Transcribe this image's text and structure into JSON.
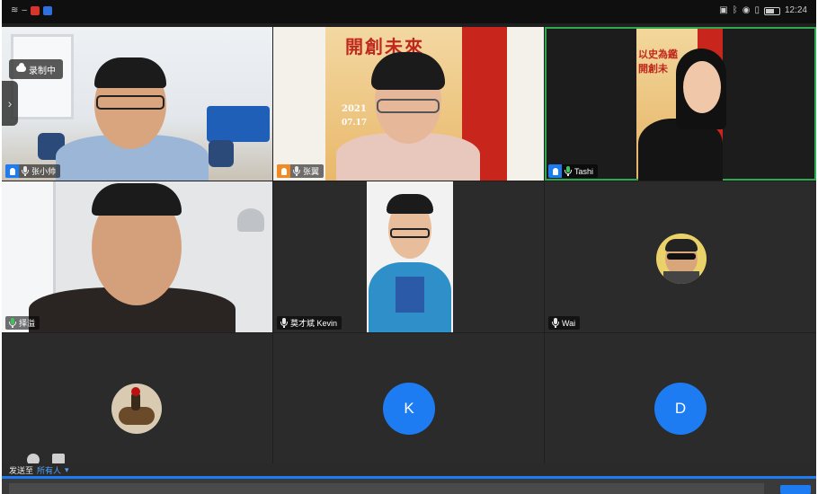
{
  "status_bar": {
    "clock": "12:24"
  },
  "recording": {
    "label": "录制中"
  },
  "participants": [
    {
      "name": "张小帅",
      "role": "host",
      "mic": "on"
    },
    {
      "name": "张翼",
      "role": "cohost",
      "mic": "on"
    },
    {
      "name": "Tashi",
      "role": "host",
      "mic": "on"
    },
    {
      "name": "择溢",
      "role": "none",
      "mic": "speaking"
    },
    {
      "name": "莫才斌 Kevin",
      "role": "none",
      "mic": "on"
    },
    {
      "name": "Wai",
      "role": "none",
      "mic": "on"
    },
    {
      "name": "",
      "role": "none",
      "mic": "off"
    },
    {
      "name": "",
      "avatar_letter": "K",
      "role": "none",
      "mic": "off"
    },
    {
      "name": "",
      "avatar_letter": "D",
      "role": "none",
      "mic": "off"
    }
  ],
  "posters": {
    "title_a": "開創未來",
    "year_a": "2021",
    "date_a": "07.17",
    "title_b": "以史為鑑",
    "title_c": "開創未"
  },
  "chat": {
    "send_to_label": "发送至",
    "send_to_target": "所有人"
  },
  "colors": {
    "accent": "#1e7cf2",
    "active_speaker": "#2fa84f",
    "cohost": "#f08a24"
  },
  "icons": {
    "chevron": "›"
  }
}
